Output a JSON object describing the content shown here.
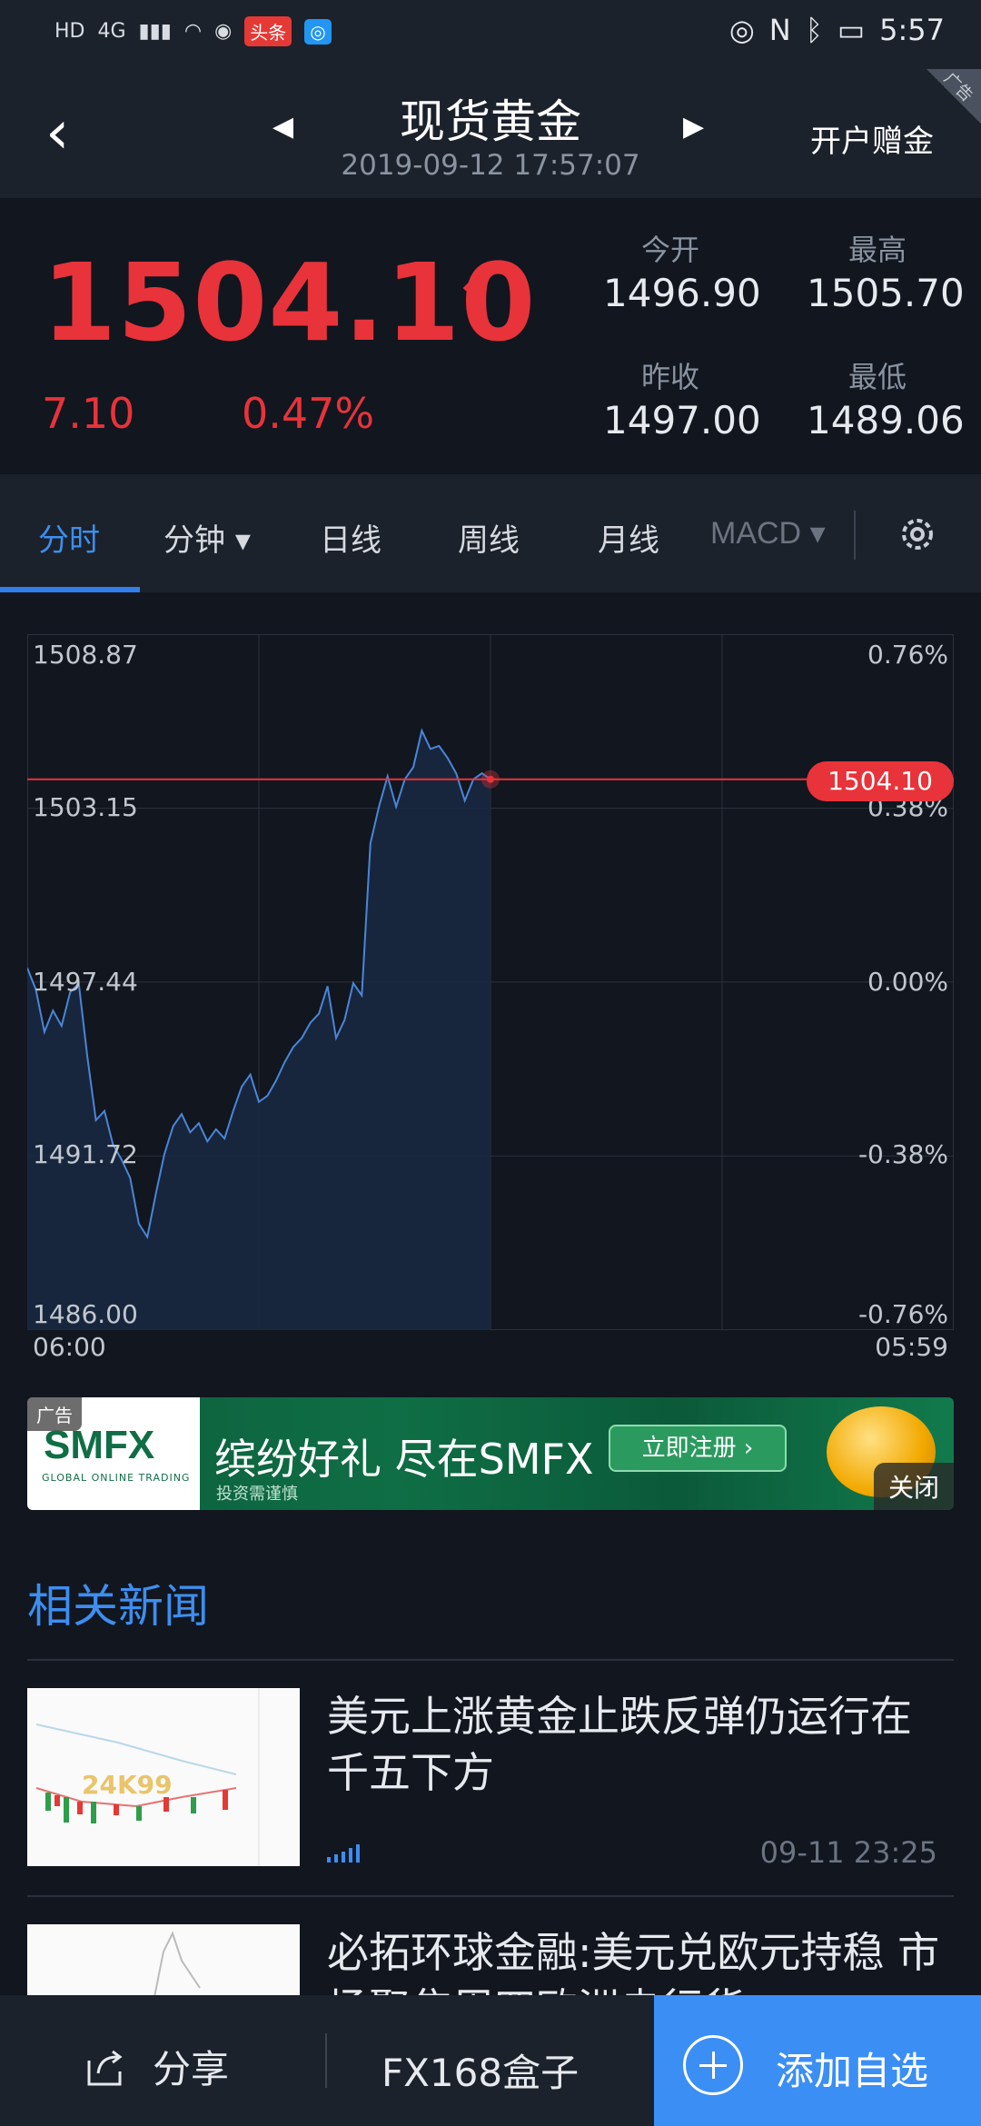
{
  "status_bar": {
    "network": "4G",
    "app_badge": "头条",
    "time": "5:57"
  },
  "header": {
    "title": "现货黄金",
    "subtitle": "2019-09-12 17:57:07",
    "right_link": "开户赠金",
    "ad_corner": "广告"
  },
  "quote": {
    "price": "1504.10",
    "change": "7.10",
    "change_pct": "0.47%",
    "stats": {
      "open_label": "今开",
      "open_value": "1496.90",
      "high_label": "最高",
      "high_value": "1505.70",
      "prev_close_label": "昨收",
      "prev_close_value": "1497.00",
      "low_label": "最低",
      "low_value": "1489.06"
    },
    "up_color": "#e8333a"
  },
  "tabs": [
    "分时",
    "分钟",
    "日线",
    "周线",
    "月线",
    "MACD"
  ],
  "chart_data": {
    "type": "area",
    "title": "",
    "x_start_label": "06:00",
    "x_end_label": "05:59",
    "y_left_ticks": [
      "1508.87",
      "1503.15",
      "1497.44",
      "1491.72",
      "1486.00"
    ],
    "y_right_ticks": [
      "0.76%",
      "0.38%",
      "0.00%",
      "-0.38%",
      "-0.76%"
    ],
    "ylim": [
      1486.0,
      1508.87
    ],
    "current_price_label": "1504.10",
    "current_price": 1504.1,
    "line_color": "#4a86d8",
    "x_fraction_range": [
      0.0,
      0.5
    ],
    "values": [
      1497.9,
      1497.2,
      1495.8,
      1496.5,
      1496.0,
      1497.1,
      1497.4,
      1495.0,
      1492.9,
      1493.2,
      1492.1,
      1491.6,
      1491.0,
      1489.5,
      1489.06,
      1490.5,
      1491.8,
      1492.7,
      1493.1,
      1492.5,
      1492.8,
      1492.2,
      1492.6,
      1492.3,
      1493.2,
      1494.0,
      1494.4,
      1493.5,
      1493.7,
      1494.2,
      1494.8,
      1495.3,
      1495.6,
      1496.1,
      1496.4,
      1497.3,
      1495.6,
      1496.2,
      1497.4,
      1497.0,
      1502.0,
      1503.2,
      1504.2,
      1503.2,
      1504.1,
      1504.5,
      1505.7,
      1505.1,
      1505.2,
      1504.8,
      1504.3,
      1503.4,
      1504.1,
      1504.3,
      1504.1
    ]
  },
  "banner": {
    "ad_label": "广告",
    "logo": "SMFX",
    "logo_sub": "GLOBAL ONLINE TRADING",
    "text": "缤纷好礼 尽在SMFX",
    "sub": "投资需谨慎",
    "button": "立即注册 ›",
    "close": "关闭"
  },
  "news": {
    "section_title": "相关新闻",
    "items": [
      {
        "title": "美元上涨黄金止跌反弹仍运行在千五下方",
        "time": "09-11 23:25",
        "thumb_text": "24K99"
      },
      {
        "title": "必拓环球金融:美元兑欧元持稳 市场聚焦周四欧洲央行货",
        "time": ""
      }
    ]
  },
  "bottom_bar": {
    "share": "分享",
    "box": "FX168盒子",
    "add": "添加自选"
  }
}
